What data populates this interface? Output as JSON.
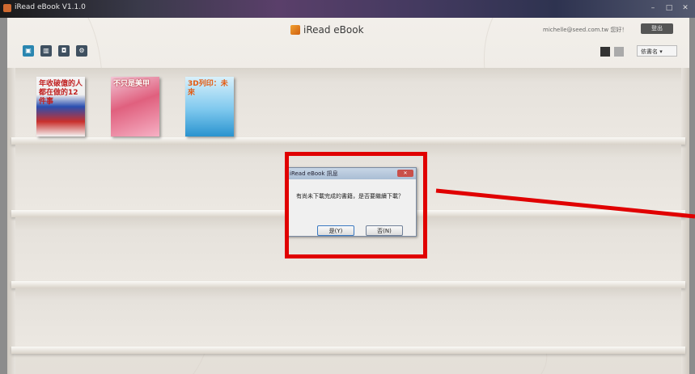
{
  "window": {
    "title": "iRead eBook V1.1.0",
    "controls": {
      "minimize": "–",
      "maximize": "□",
      "close": "✕"
    }
  },
  "header": {
    "brand": "iRead eBook",
    "user_email": "michelle@seed.com.tw",
    "user_greeting": "您好！",
    "user_button": "登出"
  },
  "toolbar": {
    "tools": [
      {
        "name": "bookshelf",
        "icon": "bookshelf-icon"
      },
      {
        "name": "reader",
        "icon": "book-icon"
      },
      {
        "name": "download",
        "icon": "download-icon"
      },
      {
        "name": "settings",
        "icon": "settings-icon"
      }
    ],
    "sort_label": "依書名"
  },
  "books": [
    {
      "title": "年收破億的人都在做的12件事"
    },
    {
      "title": "不只是美甲"
    },
    {
      "title": "3D列印：未來"
    }
  ],
  "dialog": {
    "title": "iRead eBook 訊息",
    "message": "有尚未下載完成的書籍，是否要繼續下載？",
    "yes_label": "是(Y)",
    "no_label": "否(N)"
  },
  "annotation": {
    "color": "#e00000"
  }
}
